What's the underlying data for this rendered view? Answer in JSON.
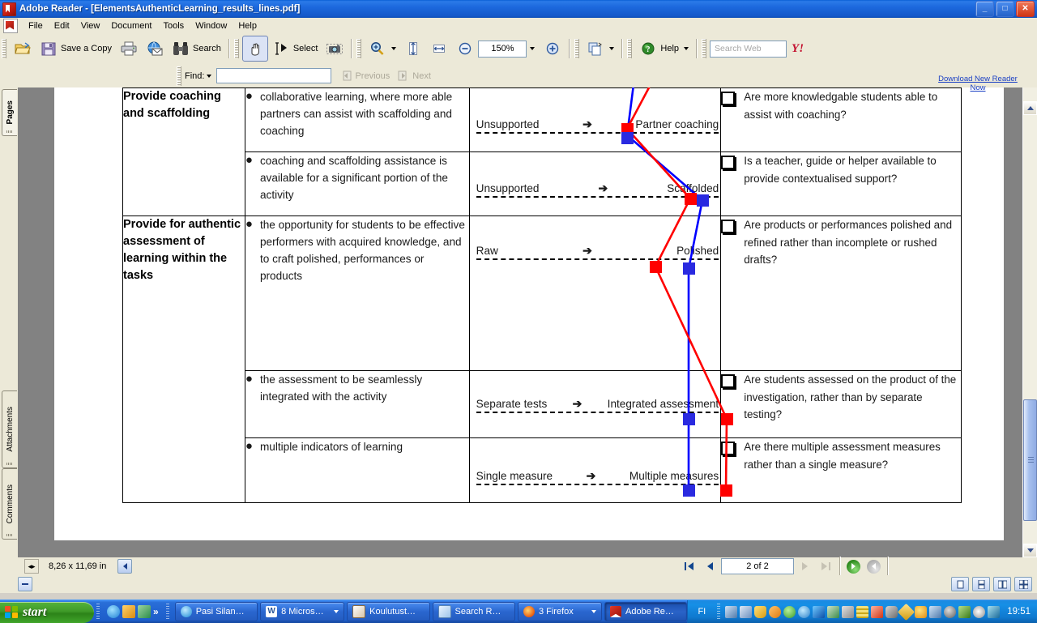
{
  "window": {
    "title": "Adobe Reader - [ElementsAuthenticLearning_results_lines.pdf]",
    "app_icon": "adobe-reader-icon",
    "minimize": "_",
    "maximize": "□",
    "close": "✕"
  },
  "menu": {
    "items": [
      "File",
      "Edit",
      "View",
      "Document",
      "Tools",
      "Window",
      "Help"
    ]
  },
  "toolbar": {
    "open_label": "",
    "save_label": "Save a Copy",
    "print_label": "",
    "email_label": "",
    "search_label": "Search",
    "hand_label": "",
    "select_label": "Select",
    "snapshot_label": "",
    "zoom_label": "",
    "fitpage_label": "",
    "fitwidth_label": "",
    "zoom_out_label": "",
    "zoom_value": "150%",
    "zoom_in_label": "",
    "pages_label": "",
    "help_label": "Help",
    "search_web_placeholder": "Search Web",
    "yahoo_label": "Y!"
  },
  "promo": {
    "line1": "Download New Reader",
    "line2": "Now"
  },
  "findbar": {
    "label": "Find:",
    "value": "",
    "previous": "Previous",
    "next": "Next"
  },
  "sidebar": {
    "tabs": [
      {
        "label": "Pages",
        "selected": true
      },
      {
        "label": "Attachments",
        "selected": false
      },
      {
        "label": "Comments",
        "selected": false
      }
    ]
  },
  "status": {
    "page_size": "8,26 x 11,69 in",
    "page_indicator": "2 of 2",
    "first_page": "first-page",
    "prev_page": "previous-page",
    "next_page": "next-page",
    "last_page": "last-page",
    "back_view": "previous-view",
    "forward_view": "next-view"
  },
  "taskbar": {
    "start_label": "start",
    "quick_launch": [
      "internet-explorer-icon",
      "outlook-icon",
      "show-contacts-icon"
    ],
    "quick_more": "»",
    "items": [
      {
        "label": "Pasi Silan…",
        "icon": "messenger-icon",
        "active": false,
        "group": false
      },
      {
        "label": "8 Micros…",
        "icon": "word-icon",
        "active": false,
        "group": true
      },
      {
        "label": "Koulutust…",
        "icon": "word-doc-icon",
        "active": false,
        "group": false
      },
      {
        "label": "Search R…",
        "icon": "explorer-icon",
        "active": false,
        "group": false
      },
      {
        "label": "3 Firefox",
        "icon": "firefox-icon",
        "active": false,
        "group": true
      },
      {
        "label": "Adobe Re…",
        "icon": "adobe-reader-icon",
        "active": true,
        "group": false
      }
    ],
    "language": "FI",
    "clock": "19:51",
    "tray_icons": [
      "network-disconnected-icon",
      "network-icon",
      "security-shield-icon",
      "update-arrows-icon",
      "antivirus-check-icon",
      "bluetooth-globe-icon",
      "bluetooth-icon",
      "users-error-icon",
      "printer-icon",
      "storage-icon",
      "volume-icon",
      "webcam-icon",
      "diamond-icon",
      "smiley-icon",
      "network-x-icon",
      "disk-icon",
      "leaf-icon",
      "spiral-icon",
      "scissors-icon"
    ]
  },
  "document": {
    "rows": [
      {
        "element": "Provide coaching and scaffolding",
        "element_rowspan": 2,
        "bullet": "collaborative learning, where more able partners can assist with scaffolding and coaching",
        "scale_left": "Unsupported",
        "scale_arrow": "➔",
        "scale_right": "Partner coaching",
        "question": "Are more knowledgable students able to assist with coaching?"
      },
      {
        "element": "",
        "bullet": "coaching and scaffolding assistance is available for a significant portion of the activity",
        "scale_left": "Unsupported",
        "scale_arrow": "➔",
        "scale_right": "Scaffolded",
        "question": "Is a teacher, guide or helper available to provide contextualised support?"
      },
      {
        "element": "Provide for authentic assessment of learning within the tasks",
        "element_rowspan": 3,
        "bullet": "the opportunity for students to be effective performers with acquired knowledge, and to craft polished, performances or products",
        "scale_left": "Raw",
        "scale_arrow": "➔",
        "scale_right": "Polished",
        "question": "Are products or performances polished and refined rather than incomplete or rushed drafts?"
      },
      {
        "element": "",
        "bullet": "the assessment to be seamlessly integrated with the activity",
        "scale_left": "Separate tests",
        "scale_arrow": "➔",
        "scale_right": "Integrated assessment",
        "question": "Are students assessed on the product of the investigation, rather than by separate testing?"
      },
      {
        "element": "",
        "bullet": "multiple indicators of learning",
        "scale_left": "Single measure",
        "scale_arrow": "➔",
        "scale_right": "Multiple measures",
        "question": "Are there multiple assessment measures rather than a single measure?"
      }
    ]
  },
  "chart_data": {
    "type": "line",
    "title": "",
    "xlabel": "",
    "ylabel": "",
    "colors": {
      "series_1": "#0000ff",
      "series_2": "#ff0000"
    },
    "categories": [
      "Partner coaching",
      "Scaffolded",
      "Polished",
      "Integrated assessment",
      "Multiple measures"
    ],
    "x_axis_scales": [
      {
        "left": "Unsupported",
        "right": "Partner coaching"
      },
      {
        "left": "Unsupported",
        "right": "Scaffolded"
      },
      {
        "left": "Raw",
        "right": "Polished"
      },
      {
        "left": "Separate tests",
        "right": "Integrated assessment"
      },
      {
        "left": "Single measure",
        "right": "Multiple measures"
      }
    ],
    "series": [
      {
        "name": "blue",
        "color": "#0000ff",
        "values": [
          0.56,
          0.85,
          0.82,
          0.8,
          0.8
        ]
      },
      {
        "name": "red",
        "color": "#ff0000",
        "values": [
          0.55,
          0.78,
          0.68,
          0.96,
          0.9
        ]
      }
    ],
    "marker": "square",
    "grid": false,
    "legend": "none",
    "xlim": [
      0,
      1
    ]
  }
}
